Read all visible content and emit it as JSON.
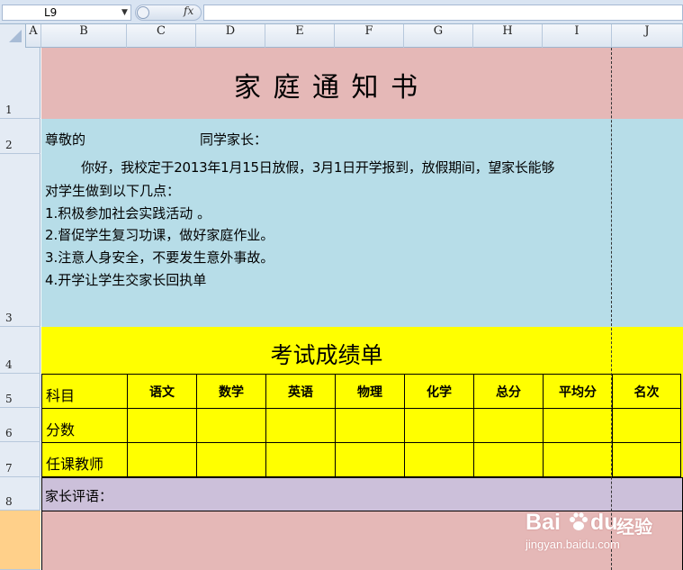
{
  "formula_bar": {
    "name_box": "L9",
    "fx": "fx",
    "formula": ""
  },
  "columns": [
    "A",
    "B",
    "C",
    "D",
    "E",
    "F",
    "G",
    "H",
    "I",
    "J"
  ],
  "rows": [
    "1",
    "2",
    "3",
    "4",
    "5",
    "6",
    "7",
    "8"
  ],
  "sheet": {
    "title": "家 庭 通 知 书",
    "greeting_prefix": "尊敬的",
    "greeting_suffix": "同学家长：",
    "body_line1": "你好，我校定于2013年1月15日放假，3月1日开学报到，放假期间，望家长能够",
    "body_line2": "对学生做到以下几点：",
    "items": [
      "1.积极参加社会实践活动 。",
      "2.督促学生复习功课，做好家庭作业。",
      "3.注意人身安全，不要发生意外事故。",
      "4.开学让学生交家长回执单"
    ],
    "score_title": "考试成绩单",
    "table": {
      "headers": [
        "科目",
        "语文",
        "数学",
        "英语",
        "物理",
        "化学",
        "总分",
        "平均分",
        "名次"
      ],
      "row_labels": [
        "分数",
        "任课教师"
      ]
    },
    "parent_comment": "家长评语："
  },
  "watermark": {
    "brand": "Bai",
    "brand2": "du",
    "brand3": "经验",
    "url": "jingyan.baidu.com"
  },
  "colors": {
    "title_band": "#e5b8b7",
    "body_band": "#b7dde8",
    "score_band": "#ffff00",
    "comment_band": "#ccc0da",
    "bottom_band": "#e5b8b7",
    "selected_row_header": "#ffd08a"
  }
}
